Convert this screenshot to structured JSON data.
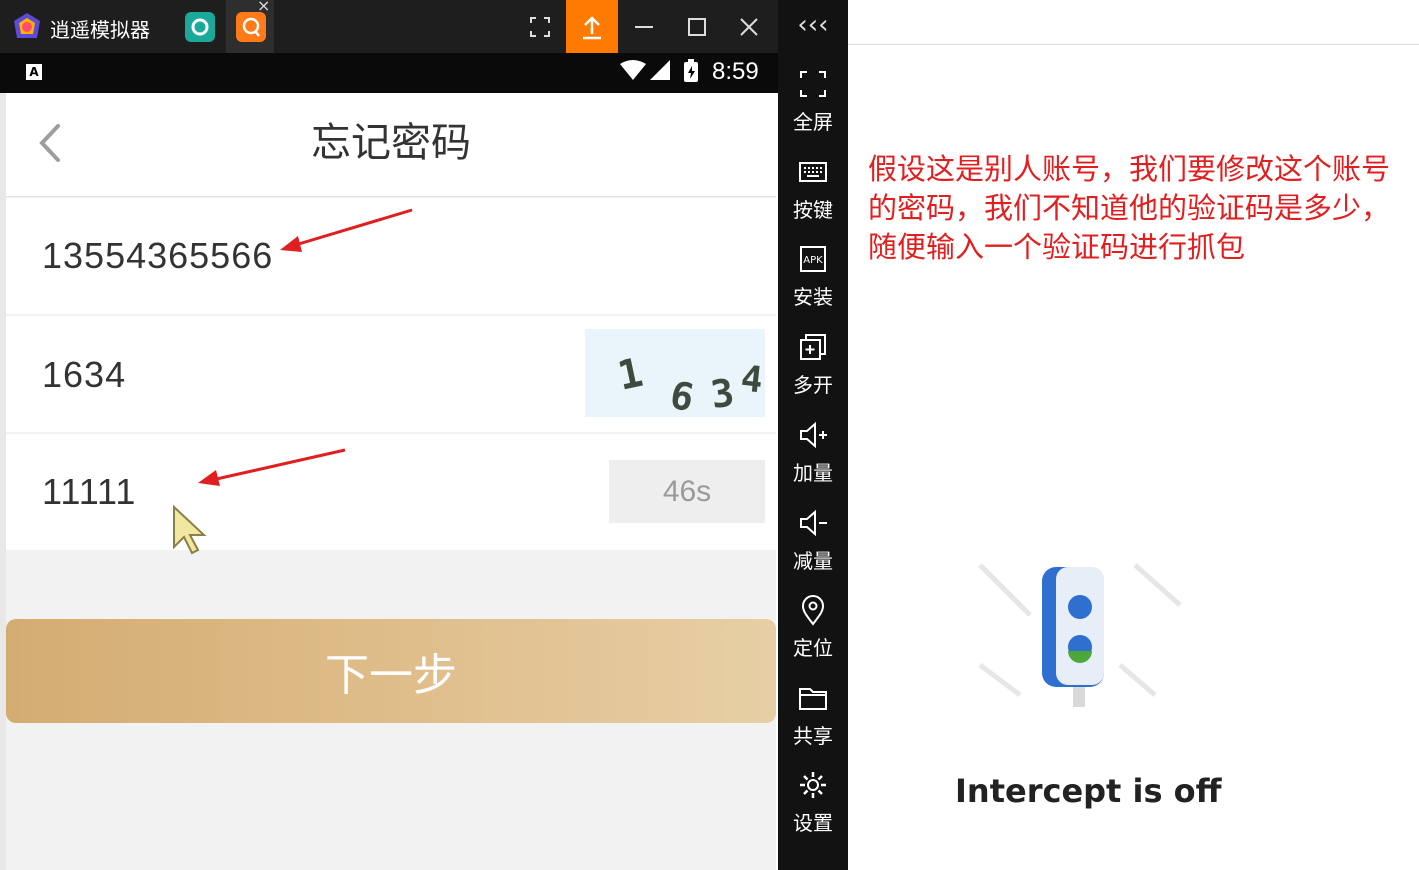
{
  "emulator": {
    "title": "逍遥模拟器",
    "tab_close_glyph": "×",
    "status_bar": {
      "indicator": "A",
      "time": "8:59"
    },
    "sidebar": {
      "collapse_glyph": "‹‹‹",
      "items": [
        {
          "label": "全屏",
          "icon": "fullscreen-icon"
        },
        {
          "label": "按键",
          "icon": "keyboard-icon"
        },
        {
          "label": "安装",
          "icon": "apk-icon"
        },
        {
          "label": "多开",
          "icon": "multi-instance-icon"
        },
        {
          "label": "加量",
          "icon": "volume-up-icon"
        },
        {
          "label": "减量",
          "icon": "volume-down-icon"
        },
        {
          "label": "定位",
          "icon": "location-icon"
        },
        {
          "label": "共享",
          "icon": "folder-icon"
        },
        {
          "label": "设置",
          "icon": "settings-icon"
        }
      ]
    }
  },
  "app": {
    "page_title": "忘记密码",
    "phone_value": "13554365566",
    "captcha_value": "1634",
    "captcha_image_text": [
      "1",
      "6",
      "3",
      "4"
    ],
    "sms_code_value": "11111",
    "countdown": "46s",
    "next_button": "下一步"
  },
  "right_panel": {
    "annotation": "假设这是别人账号，我们要修改这个账号的密码，我们不知道他的验证码是多少，随便输入一个验证码进行抓包",
    "intercept_status": "Intercept is off"
  },
  "colors": {
    "accent_orange": "#ff7a00",
    "button_gold": "#d3ac72",
    "annotation_red": "#e02020",
    "arrow_red": "#e02020"
  }
}
